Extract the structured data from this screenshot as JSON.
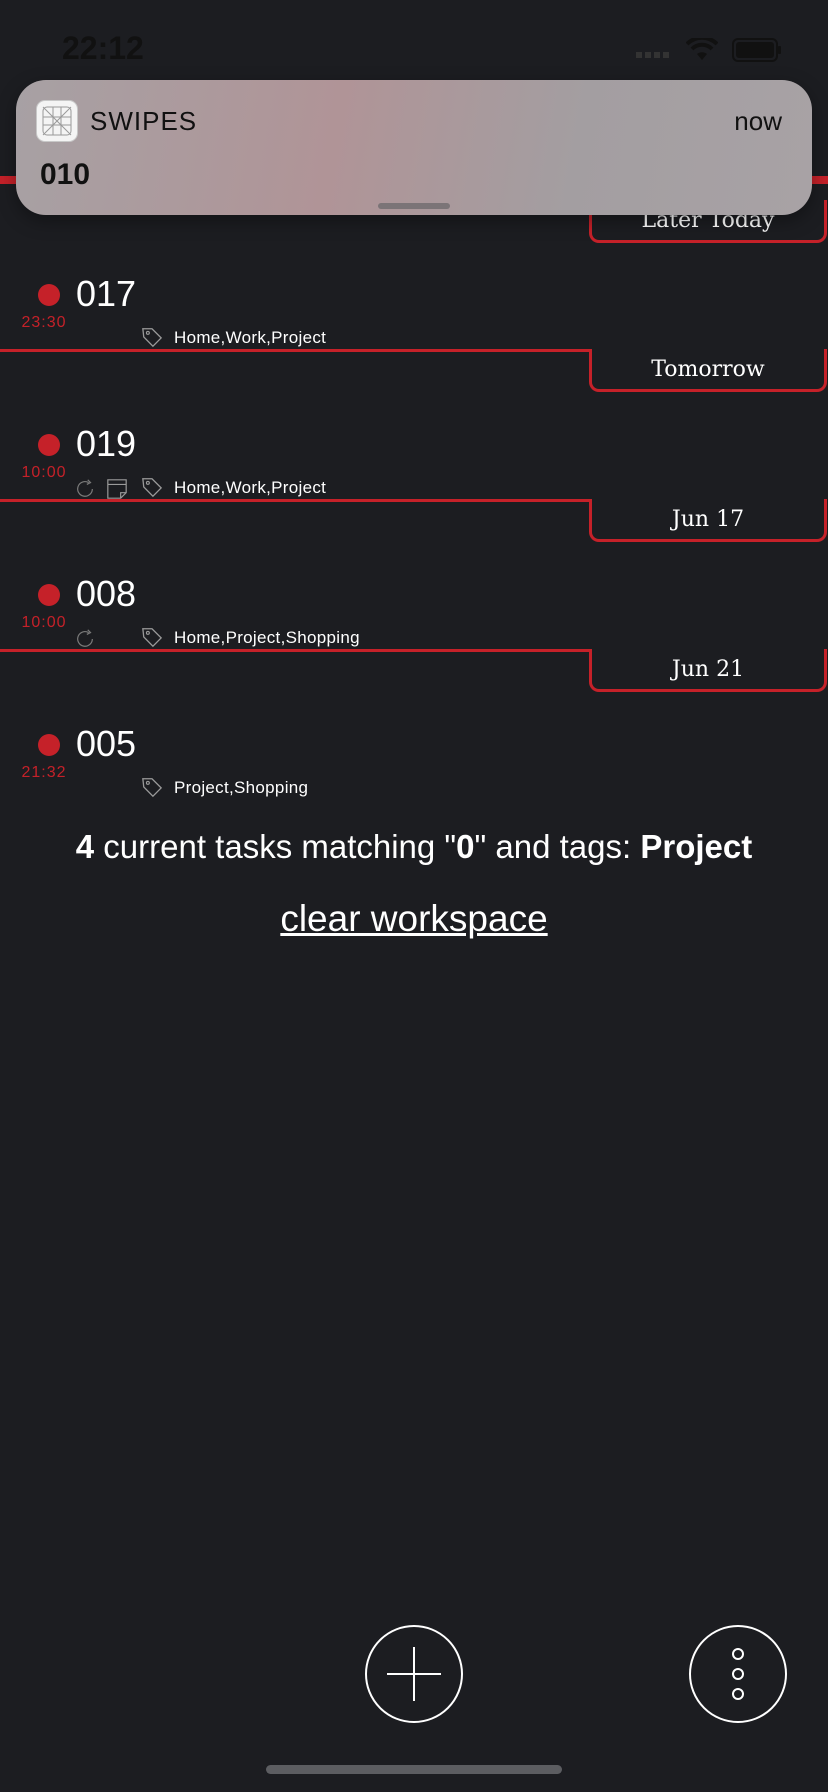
{
  "status_bar": {
    "time": "22:12"
  },
  "notification": {
    "app_name": "SWIPES",
    "when": "now",
    "message": "010"
  },
  "sections": [
    {
      "label": "Later Today"
    },
    {
      "label": "Tomorrow"
    },
    {
      "label": "Jun 17"
    },
    {
      "label": "Jun 21"
    }
  ],
  "tasks": [
    {
      "title": "017",
      "time": "23:30",
      "tags": "Home,Work,Project",
      "repeat": false,
      "note": false
    },
    {
      "title": "019",
      "time": "10:00",
      "tags": "Home,Work,Project",
      "repeat": true,
      "note": true
    },
    {
      "title": "008",
      "time": "10:00",
      "tags": "Home,Project,Shopping",
      "repeat": true,
      "note": false
    },
    {
      "title": "005",
      "time": "21:32",
      "tags": "Project,Shopping",
      "repeat": false,
      "note": false
    }
  ],
  "summary": {
    "count": "4",
    "text1": " current tasks matching \"",
    "query": "0",
    "text2": "\" and tags: ",
    "tag": "Project"
  },
  "clear_label": "clear workspace",
  "colors": {
    "accent": "#c52129",
    "background": "#1c1d21"
  },
  "icons": {
    "add": "plus-icon",
    "more": "more-vertical-icon",
    "tag": "tag-icon",
    "repeat": "repeat-icon",
    "note": "note-icon"
  }
}
